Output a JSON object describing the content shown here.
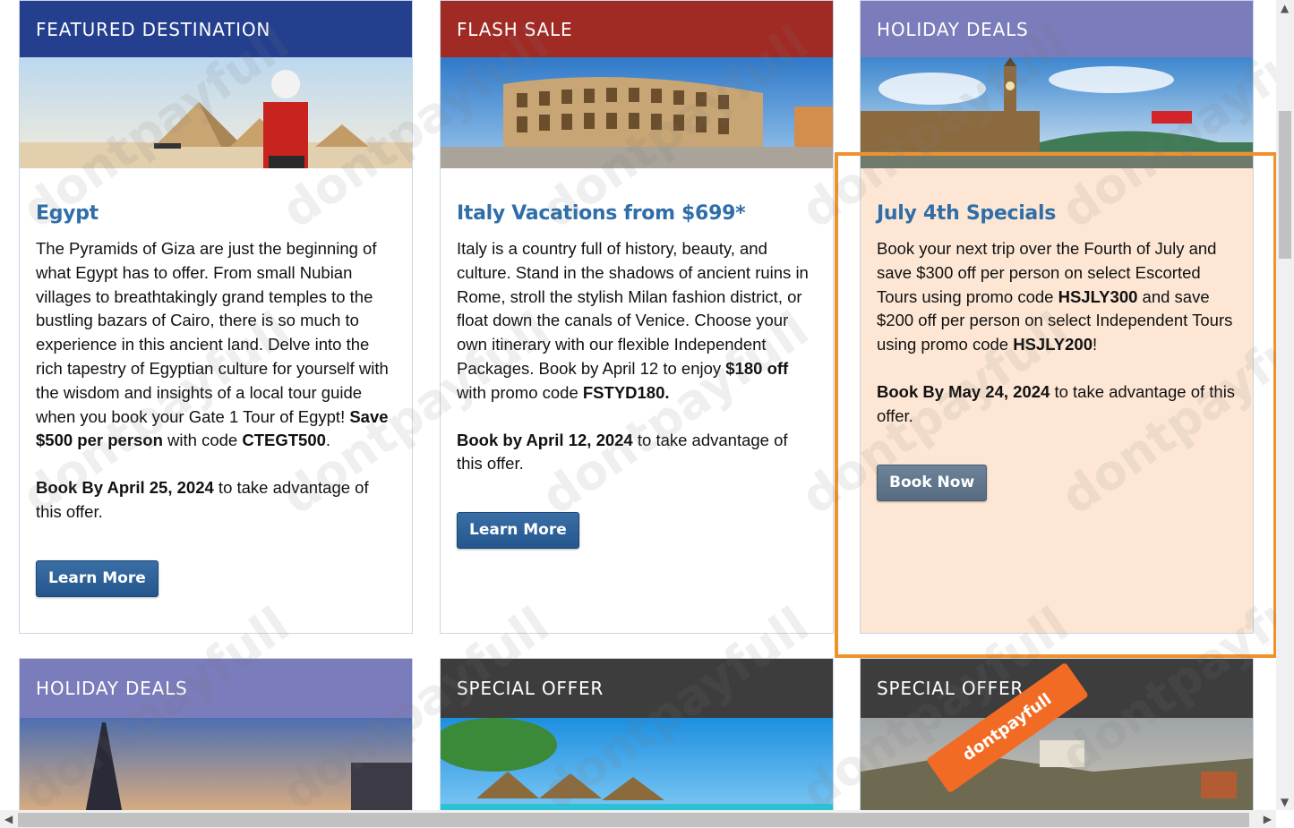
{
  "cards": [
    {
      "header": "FEATURED DESTINATION",
      "header_color": "#243f8e",
      "title": "Egypt",
      "paragraph_parts": [
        "The Pyramids of Giza are just the beginning of what Egypt has to offer. From small Nubian villages to breathtakingly grand temples to the bustling bazars of Cairo, there is so much to experience in this ancient land. Delve into the rich tapestry of Egyptian culture for yourself with the wisdom and insights of a local tour guide when you book your Gate 1 Tour of Egypt! ",
        "Save $500 per person",
        " with code ",
        "CTEGT500",
        "."
      ],
      "deadline_bold": "Book By April 25, 2024",
      "deadline_rest": " to take advantage of this offer.",
      "button": "Learn More"
    },
    {
      "header": "FLASH SALE",
      "header_color": "#a02a24",
      "title": "Italy Vacations from $699*",
      "paragraph_parts": [
        "Italy is a country full of history, beauty, and culture. Stand in the shadows of ancient ruins in Rome, stroll the stylish Milan fashion district, or float down the canals of Venice. Choose your own itinerary with our flexible Independent Packages. Book by April 12 to enjoy ",
        "$180 off",
        " with promo code ",
        "FSTYD180."
      ],
      "deadline_bold": "Book by April 12, 2024",
      "deadline_rest": " to take advantage of this offer.",
      "button": "Learn More"
    },
    {
      "header": "HOLIDAY DEALS",
      "header_color": "#7b7cbb",
      "title": "July 4th Specials",
      "paragraph_parts": [
        "Book your next trip over the Fourth of July and save $300 off per person on select Escorted Tours using promo code ",
        "HSJLY300",
        " and save $200 off per person on select Independent Tours using promo code ",
        "HSJLY200",
        "!"
      ],
      "deadline_bold": "Book By May 24, 2024",
      "deadline_rest": " to take advantage of this offer.",
      "button": "Book Now"
    },
    {
      "header": "HOLIDAY DEALS",
      "header_color": "#7b7cbb"
    },
    {
      "header": "SPECIAL OFFER",
      "header_color": "#3d3d3d"
    },
    {
      "header": "SPECIAL OFFER",
      "header_color": "#3d3d3d"
    }
  ],
  "watermark": "dontpayfull",
  "ribbon": "dontpayfull",
  "highlight_color": "#f0922b"
}
